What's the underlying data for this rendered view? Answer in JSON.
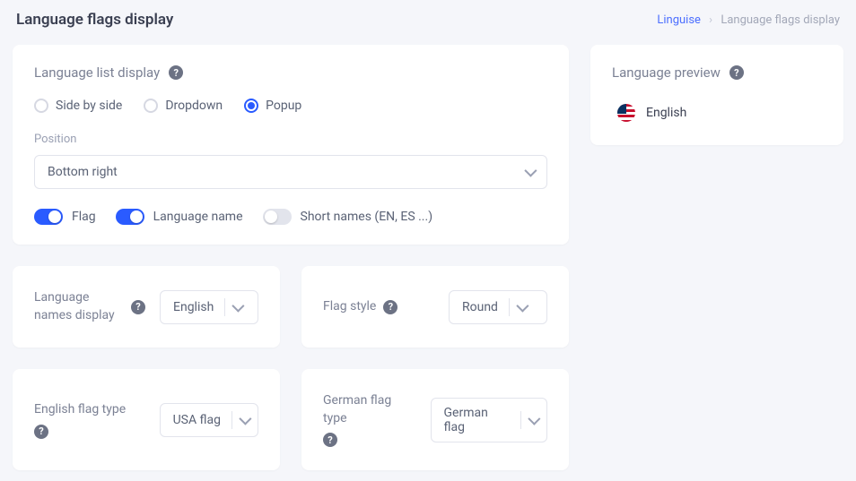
{
  "header": {
    "title": "Language flags display"
  },
  "breadcrumb": {
    "root": "Linguise",
    "current": "Language flags display"
  },
  "main": {
    "section_title": "Language list display",
    "display_mode": {
      "options": [
        {
          "label": "Side by side",
          "selected": false
        },
        {
          "label": "Dropdown",
          "selected": false
        },
        {
          "label": "Popup",
          "selected": true
        }
      ]
    },
    "position": {
      "label": "Position",
      "value": "Bottom right"
    },
    "toggles": {
      "flag": {
        "label": "Flag",
        "on": true
      },
      "language_name": {
        "label": "Language name",
        "on": true
      },
      "short_names": {
        "label": "Short names (EN, ES ...)",
        "on": false
      }
    }
  },
  "preview": {
    "title": "Language preview",
    "language": "English"
  },
  "names_display": {
    "label": "Language names display",
    "value": "English"
  },
  "flag_style": {
    "label": "Flag style",
    "value": "Round"
  },
  "english_flag": {
    "label": "English flag type",
    "value": "USA flag"
  },
  "german_flag": {
    "label": "German flag type",
    "value": "German flag"
  }
}
